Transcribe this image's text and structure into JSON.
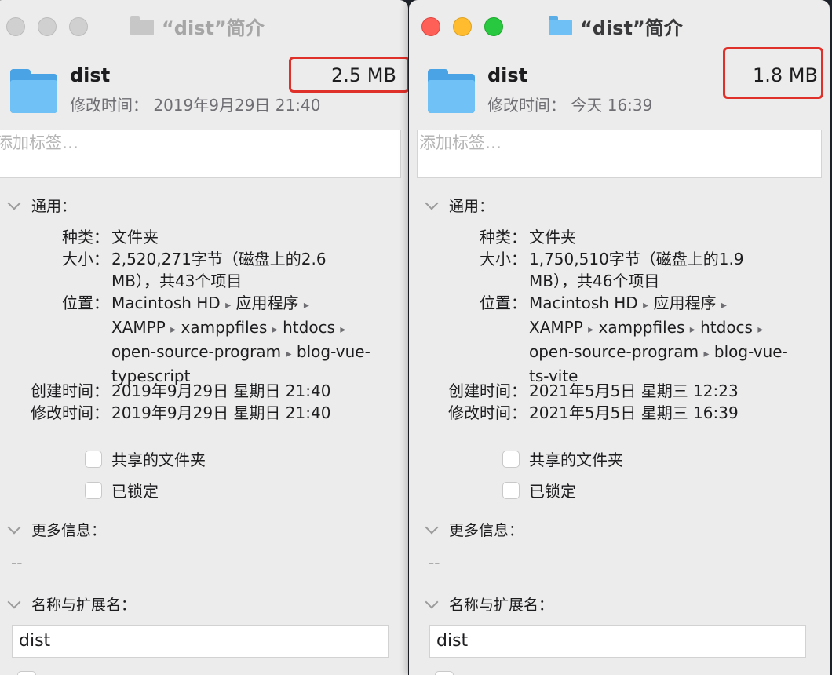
{
  "windows": [
    {
      "title": "“dist”简介",
      "name": "dist",
      "size_header": "2.5 MB",
      "modified_line": "修改时间： 2019年9月29日 21:40",
      "tags_placeholder": "添加标签…",
      "general": {
        "header": "通用：",
        "kind_label": "种类：",
        "kind": "文件夹",
        "size_label": "大小：",
        "size": "2,520,271字节（磁盘上的2.6 MB），共43个项目",
        "where_label": "位置：",
        "where_path": [
          "Macintosh HD",
          "应用程序",
          "XAMPP",
          "xamppfiles",
          "htdocs",
          "open-source-program",
          "blog-vue-typescript"
        ],
        "created_label": "创建时间：",
        "created": "2019年9月29日 星期日 21:40",
        "modified_label": "修改时间：",
        "modified": "2019年9月29日 星期日 21:40",
        "shared_folder": "共享的文件夹",
        "locked": "已锁定"
      },
      "more_info": {
        "header": "更多信息：",
        "value": "--"
      },
      "name_ext": {
        "header": "名称与扩展名：",
        "value": "dist"
      }
    },
    {
      "title": "“dist”简介",
      "name": "dist",
      "size_header": "1.8 MB",
      "modified_line": "修改时间： 今天 16:39",
      "tags_placeholder": "添加标签…",
      "general": {
        "header": "通用：",
        "kind_label": "种类：",
        "kind": "文件夹",
        "size_label": "大小：",
        "size": "1,750,510字节（磁盘上的1.9 MB），共46个项目",
        "where_label": "位置：",
        "where_path": [
          "Macintosh HD",
          "应用程序",
          "XAMPP",
          "xamppfiles",
          "htdocs",
          "open-source-program",
          "blog-vue-ts-vite"
        ],
        "created_label": "创建时间：",
        "created": "2021年5月5日 星期三 12:23",
        "modified_label": "修改时间：",
        "modified": "2021年5月5日 星期三 16:39",
        "shared_folder": "共享的文件夹",
        "locked": "已锁定"
      },
      "more_info": {
        "header": "更多信息：",
        "value": "--"
      },
      "name_ext": {
        "header": "名称与扩展名：",
        "value": "dist"
      }
    }
  ],
  "colors": {
    "highlight": "#e0302a",
    "folder": "#6fc1f6",
    "window_bg": "#ececec"
  },
  "icons": [
    "folder-icon",
    "chevron-down-icon",
    "path-arrow-icon"
  ]
}
